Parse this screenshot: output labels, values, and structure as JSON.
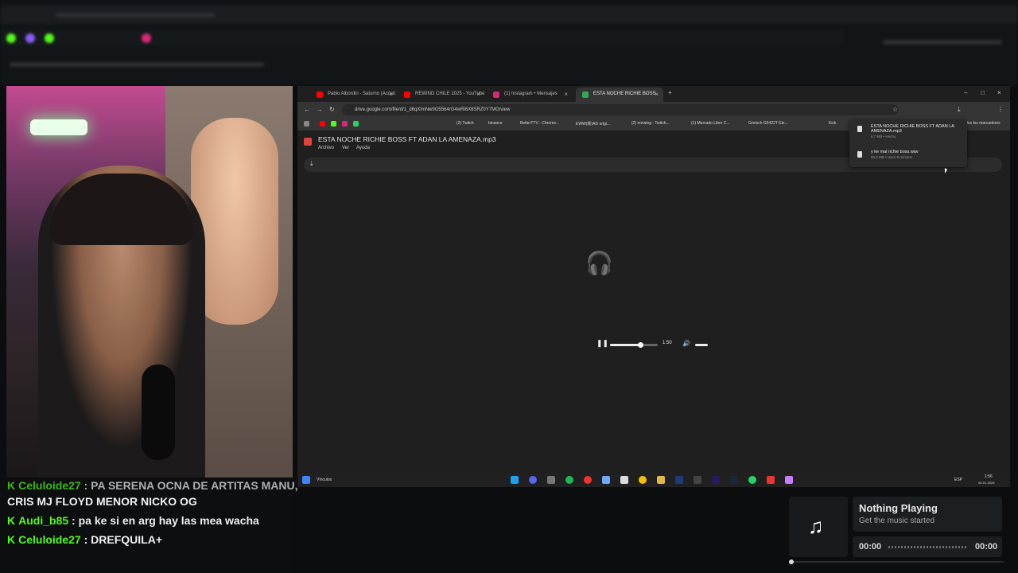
{
  "browser": {
    "tabs": [
      {
        "title": "Pablo Albordin - Saturno (Acústi",
        "color": "#ff0000"
      },
      {
        "title": "REWIND CHILE 2025 - YouTube",
        "color": "#ff0000"
      },
      {
        "title": "(1) Instagram • Mensajes",
        "color": "#d62976"
      },
      {
        "title": "ESTA NOCHE RICHIE BOSS",
        "color": "#34a853"
      }
    ],
    "url": "drive.google.com/file/d/1_d6qXlmNw9O5564rG4wRi6X8SRZ0Y7MG/view",
    "bookmarks": [
      "(2) Twitch",
      "binance",
      "BetterTTV - Chrome...",
      "EWW(新)AD origi...",
      "(2) norwing - Twitch...",
      "(1) Mercado Libre C...",
      "Gretsch G5422T Ele...",
      "Kick",
      "dos los marcadores"
    ]
  },
  "drive": {
    "file_title": "ESTA NOCHE RICHIE BOSS FT ADAN LA AMENAZA.mp3",
    "menu": [
      "Archivo",
      "Ver",
      "Ayuda"
    ],
    "player": {
      "time": "1:50",
      "progress": 0.62
    }
  },
  "downloads": [
    {
      "name": "ESTA NOCHE RICHIE BOSS FT ADAN LA AMENAZA.mp3",
      "meta": "6,7 MB • Hecho"
    },
    {
      "name": "y ke mal richie boss.wav",
      "meta": "56,3 MB • Hace 8 minutos"
    }
  ],
  "taskbar": {
    "label": "Vínculos",
    "lang": "ESP",
    "time": "1:56",
    "date": "04-01-2026"
  },
  "chat": [
    {
      "user": "Celuloide27",
      "text": "PA SERENA OCNA DE ARTITAS MANU,"
    },
    {
      "user": "",
      "text": "CRIS MJ FLOYD MENOR NICKO OG"
    },
    {
      "user": "Audi_b85",
      "text": "pa ke si en arg hay las mea wacha"
    },
    {
      "user": "Celuloide27",
      "text": "DREFQUILA+"
    }
  ],
  "now_playing": {
    "title": "Nothing Playing",
    "subtitle": "Get the music started",
    "time_start": "00:00",
    "time_end": "00:00"
  }
}
